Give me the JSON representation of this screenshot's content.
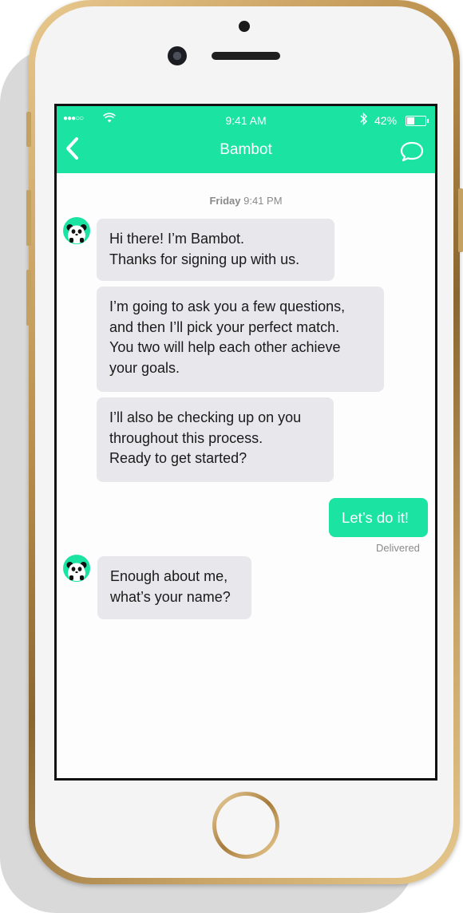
{
  "status_bar": {
    "signal": "●●●○○",
    "time": "9:41 AM",
    "battery": "42%"
  },
  "nav": {
    "back_icon": "chevron-left",
    "title": "Bambot",
    "chat_icon": "speech-bubble"
  },
  "conversation": {
    "date_day": "Friday",
    "date_time": "9:41 PM",
    "messages": [
      {
        "sender": "bot",
        "text": "Hi there! I’m Bambot.\nThanks for signing up with us."
      },
      {
        "sender": "bot",
        "text": "I’m going to ask you a few questions,\nand then I’ll pick your perfect match.\nYou two will help each other achieve\nyour goals."
      },
      {
        "sender": "bot",
        "text": "I’ll also be checking up on you\nthroughout this process.\nReady to get started?"
      },
      {
        "sender": "user",
        "text": "Let’s do it!",
        "status": "Delivered"
      },
      {
        "sender": "bot",
        "text": "Enough about me,\nwhat’s your name?"
      }
    ]
  },
  "colors": {
    "accent": "#1be3a2",
    "bot_bubble": "#e8e8ec",
    "phone_gold": "#c9a467"
  }
}
